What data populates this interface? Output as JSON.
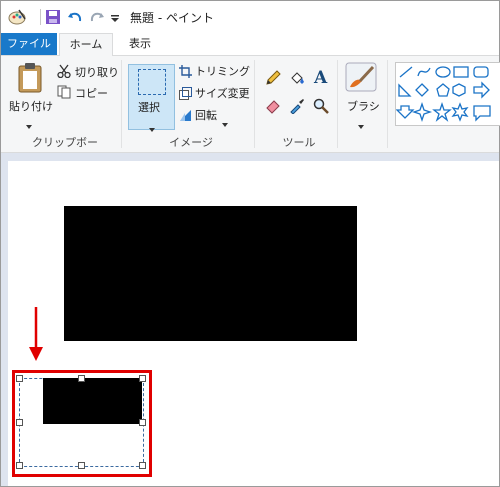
{
  "window": {
    "title": "無題 - ペイント"
  },
  "quick_access": {
    "icons": [
      "paint-app-icon",
      "save-icon",
      "undo-icon",
      "redo-icon",
      "customize-dropdown-icon"
    ]
  },
  "tabs": [
    {
      "label": "ファイル"
    },
    {
      "label": "ホーム"
    },
    {
      "label": "表示"
    }
  ],
  "ribbon": {
    "clipboard": {
      "paste": "貼り付け",
      "cut": "切り取り",
      "copy": "コピー",
      "group": "クリップボード"
    },
    "image": {
      "select": "選択",
      "crop": "トリミング",
      "resize": "サイズ変更",
      "rotate": "回転",
      "group": "イメージ"
    },
    "tools": {
      "group": "ツール",
      "text_tool": "A"
    },
    "brushes": {
      "label": "ブラシ"
    }
  },
  "colors": {
    "accent": "#1979ca",
    "selection_highlight": "#e00000",
    "arrow": "#e00000",
    "shapes_stroke": "#1a73c7"
  }
}
